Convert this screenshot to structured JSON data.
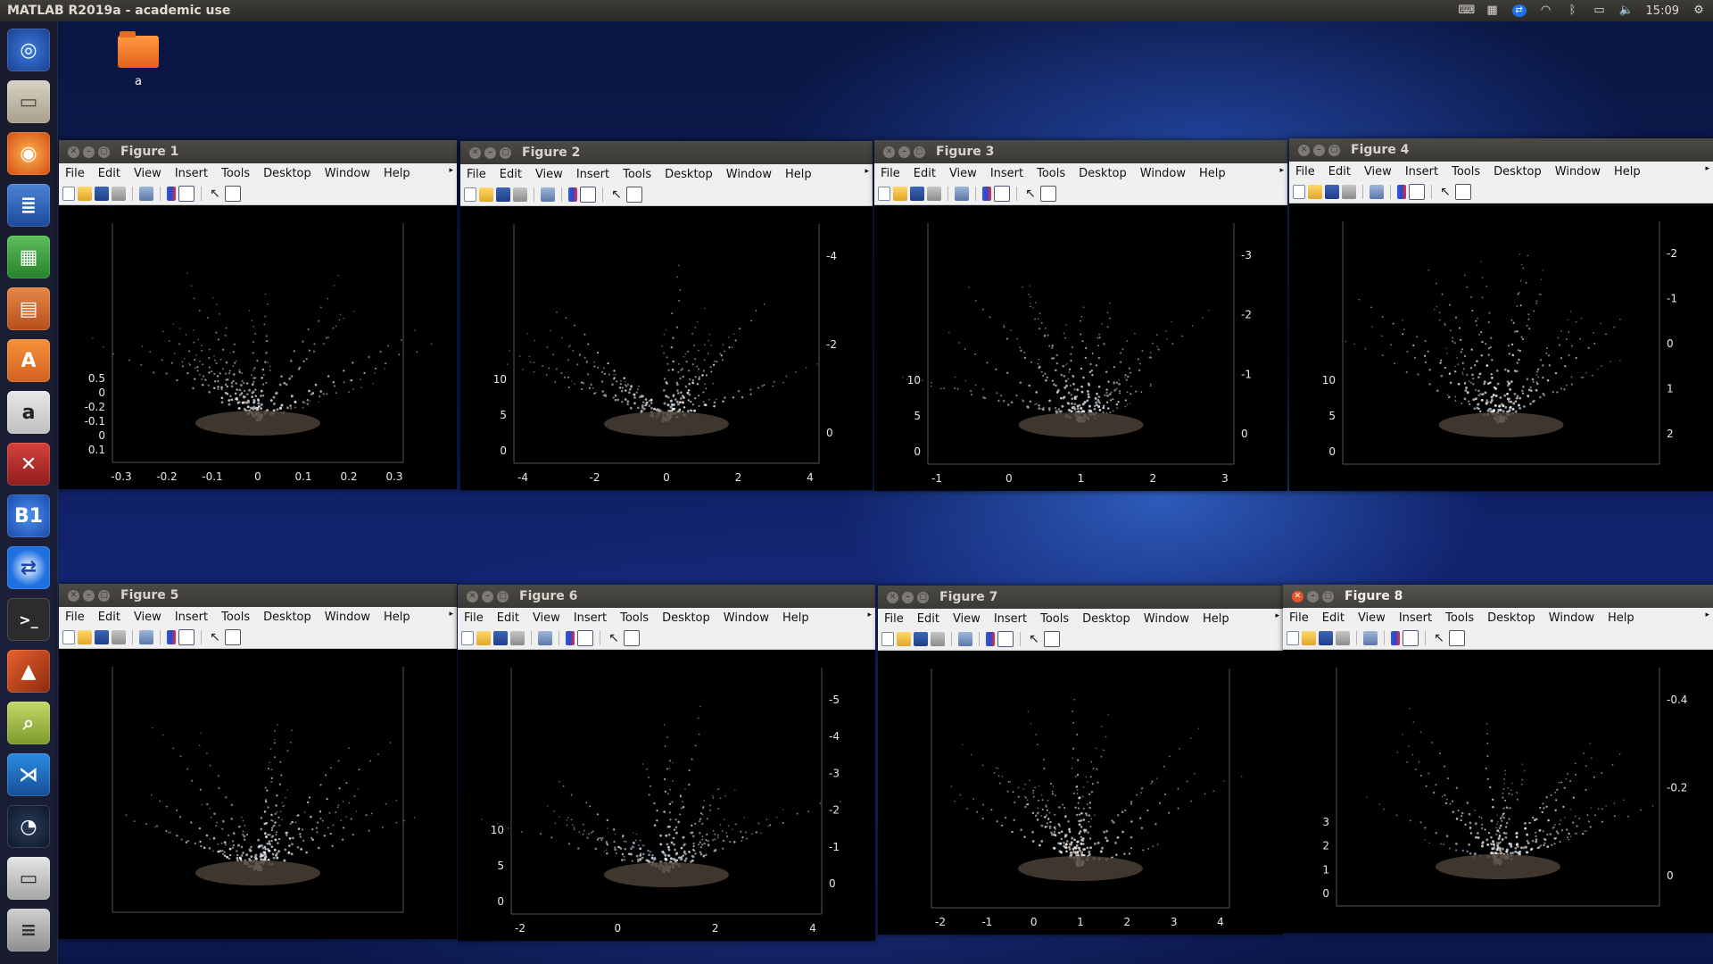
{
  "top_panel": {
    "title": "MATLAB R2019a - academic use",
    "clock": "15:09"
  },
  "launcher": {
    "items": [
      "ubuntu-dash",
      "files",
      "firefox",
      "libreoffice-writer",
      "libreoffice-calc",
      "libreoffice-impress",
      "software-center",
      "amazon",
      "system-settings",
      "b1",
      "teamviewer",
      "terminal",
      "matlab",
      "image-viewer",
      "vscode",
      "disk-usage",
      "storage"
    ]
  },
  "desktop": {
    "folder_label": "a"
  },
  "menu_labels": [
    "File",
    "Edit",
    "View",
    "Insert",
    "Tools",
    "Desktop",
    "Window",
    "Help"
  ],
  "figures": [
    {
      "title": "Figure 1",
      "active": false,
      "x_ticks": [
        "-0.3",
        "-0.2",
        "-0.1",
        "0",
        "0.1",
        "0.2",
        "0.3"
      ],
      "y_ticks": [
        "0.5",
        "0",
        "-0.2",
        "-0.1",
        "0",
        "0.1"
      ],
      "z_ticks": []
    },
    {
      "title": "Figure 2",
      "active": false,
      "x_ticks": [
        "-4",
        "-2",
        "0",
        "2",
        "4"
      ],
      "y_ticks": [
        "10",
        "5",
        "0"
      ],
      "z_ticks": [
        "-4",
        "-2",
        "0"
      ]
    },
    {
      "title": "Figure 3",
      "active": false,
      "x_ticks": [
        "-1",
        "0",
        "1",
        "2",
        "3"
      ],
      "y_ticks": [
        "10",
        "5",
        "0"
      ],
      "z_ticks": [
        "-3",
        "-2",
        "-1",
        "0"
      ]
    },
    {
      "title": "Figure 4",
      "active": false,
      "x_ticks": [],
      "y_ticks": [
        "10",
        "5",
        "0"
      ],
      "z_ticks": [
        "-2",
        "-1",
        "0",
        "1",
        "2"
      ]
    },
    {
      "title": "Figure 5",
      "active": false,
      "x_ticks": [],
      "y_ticks": [],
      "z_ticks": []
    },
    {
      "title": "Figure 6",
      "active": false,
      "x_ticks": [
        "-2",
        "0",
        "2",
        "4"
      ],
      "y_ticks": [
        "10",
        "5",
        "0"
      ],
      "z_ticks": [
        "-5",
        "-4",
        "-3",
        "-2",
        "-1",
        "0"
      ]
    },
    {
      "title": "Figure 7",
      "active": false,
      "x_ticks": [
        "-2",
        "-1",
        "0",
        "1",
        "2",
        "3",
        "4"
      ],
      "y_ticks": [],
      "z_ticks": []
    },
    {
      "title": "Figure 8",
      "active": true,
      "x_ticks": [],
      "y_ticks": [
        "3",
        "2",
        "1",
        "0"
      ],
      "z_ticks": [
        "-0.4",
        "-0.2",
        "0"
      ]
    }
  ]
}
